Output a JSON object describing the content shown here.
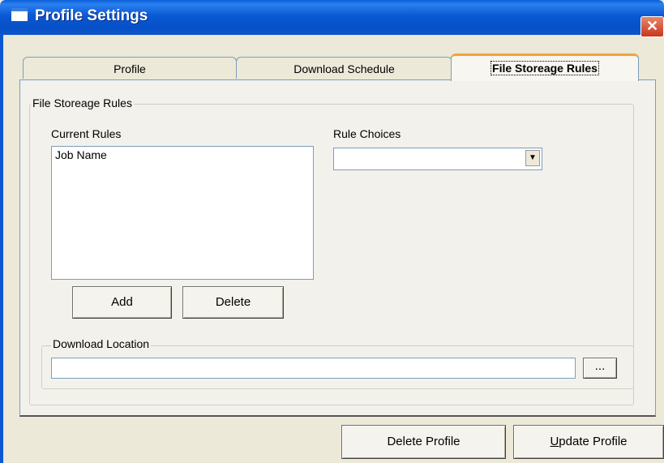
{
  "window": {
    "title": "Profile Settings",
    "close_glyph": "✕"
  },
  "tabs": [
    {
      "label": "Profile",
      "active": false
    },
    {
      "label": "Download Schedule",
      "active": false
    },
    {
      "label": "File Storeage Rules",
      "active": true
    }
  ],
  "rules_group": {
    "legend": "File Storeage Rules",
    "current_rules_label": "Current Rules",
    "current_rules_items": [
      "Job Name"
    ],
    "rule_choices_label": "Rule Choices",
    "rule_choices_value": "",
    "add_label": "Add",
    "delete_label": "Delete"
  },
  "download_group": {
    "legend": "Download Location",
    "path_value": "",
    "browse_label": "..."
  },
  "footer": {
    "delete_profile_label": "Delete Profile",
    "update_profile_label": "Update Profile"
  },
  "icons": {
    "dropdown_arrow": "▼"
  }
}
